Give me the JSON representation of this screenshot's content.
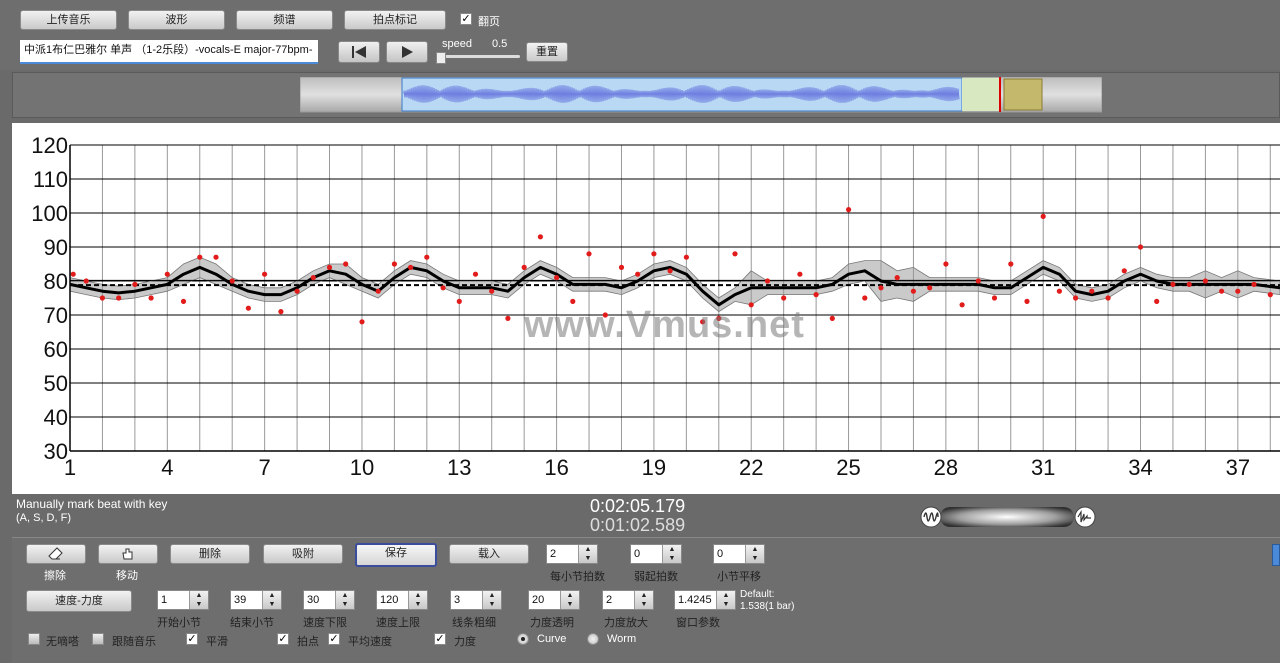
{
  "toolbar": {
    "upload": "上传音乐",
    "waveform": "波形",
    "spectrum": "频谱",
    "mark_beat": "拍点标记",
    "page_turn": "翻页",
    "speed_label": "speed",
    "speed_value": "0.5",
    "reset": "重置",
    "song_title": "中派1布仁巴雅尔 单声 （1-2乐段）-vocals-E major-77bpm-"
  },
  "chart_data": {
    "type": "line",
    "ylim": [
      30,
      120
    ],
    "yticks": [
      30,
      40,
      50,
      60,
      70,
      80,
      90,
      100,
      110,
      120
    ],
    "xlim": [
      1,
      38.3
    ],
    "xticks": [
      1,
      4,
      7,
      10,
      13,
      16,
      19,
      22,
      25,
      28,
      31,
      34,
      37
    ],
    "grid": true,
    "series": [
      {
        "kind": "curve",
        "x": [
          1,
          1.5,
          2,
          2.5,
          3,
          3.5,
          4,
          4.5,
          5,
          5.5,
          6,
          6.5,
          7,
          7.5,
          8,
          8.5,
          9,
          9.5,
          10,
          10.5,
          11,
          11.5,
          12,
          12.5,
          13,
          13.5,
          14,
          14.5,
          15,
          15.5,
          16,
          16.5,
          17,
          17.5,
          18,
          18.5,
          19,
          19.5,
          20,
          20.5,
          21,
          21.5,
          22,
          22.5,
          23,
          23.5,
          24,
          24.5,
          25,
          25.5,
          26,
          26.5,
          27,
          27.5,
          28,
          28.5,
          29,
          29.5,
          30,
          30.5,
          31,
          31.5,
          32,
          32.5,
          33,
          33.5,
          34,
          34.5,
          35,
          35.5,
          36,
          36.5,
          37,
          37.5,
          38.3
        ],
        "values": [
          79,
          78,
          77,
          76.5,
          77,
          78,
          79,
          82,
          84,
          82,
          79,
          77,
          76,
          76,
          78,
          81,
          83,
          82,
          79,
          77,
          81,
          84,
          83,
          80,
          78,
          78,
          78,
          77,
          81,
          84,
          82,
          79,
          79,
          79,
          78,
          80,
          83,
          84,
          82,
          77,
          73,
          76,
          78,
          78,
          78,
          78,
          78,
          79,
          82,
          83,
          80,
          79,
          79,
          79,
          79,
          79,
          79,
          78,
          78,
          81,
          84,
          82,
          77,
          76,
          77,
          80,
          82,
          80,
          79,
          79,
          79,
          79,
          79,
          79,
          78
        ]
      },
      {
        "kind": "band",
        "x": [
          1,
          1.5,
          2,
          2.5,
          3,
          3.5,
          4,
          4.5,
          5,
          5.5,
          6,
          6.5,
          7,
          7.5,
          8,
          8.5,
          9,
          9.5,
          10,
          10.5,
          11,
          11.5,
          12,
          12.5,
          13,
          13.5,
          14,
          14.5,
          15,
          15.5,
          16,
          16.5,
          17,
          17.5,
          18,
          18.5,
          19,
          19.5,
          20,
          20.5,
          21,
          21.5,
          22,
          22.5,
          23,
          23.5,
          24,
          24.5,
          25,
          25.5,
          26,
          26.5,
          27,
          27.5,
          28,
          28.5,
          29,
          29.5,
          30,
          30.5,
          31,
          31.5,
          32,
          32.5,
          33,
          33.5,
          34,
          34.5,
          35,
          35.5,
          36,
          36.5,
          37,
          37.5,
          38.3
        ],
        "upper": [
          81,
          80,
          79,
          78.5,
          79,
          80,
          81,
          85,
          87,
          85,
          81,
          79,
          78,
          78,
          80,
          83,
          85,
          85,
          81,
          79,
          83,
          86,
          85,
          82,
          80,
          80,
          80,
          79,
          83,
          86,
          84,
          81,
          81,
          81,
          80,
          82,
          85,
          86,
          84,
          79,
          75,
          78,
          83,
          80,
          80,
          80,
          80,
          81,
          85,
          86,
          86,
          83,
          84,
          81,
          81,
          81,
          81,
          80,
          80,
          83,
          86,
          84,
          79,
          78,
          79,
          82,
          84,
          82,
          81,
          81,
          83,
          81,
          83,
          81,
          80
        ],
        "lower": [
          77,
          76,
          75,
          74.5,
          75,
          76,
          77,
          79,
          81,
          79,
          77,
          75,
          74,
          74,
          76,
          79,
          81,
          79,
          77,
          75,
          79,
          82,
          81,
          78,
          76,
          76,
          76,
          75,
          79,
          82,
          80,
          77,
          77,
          77,
          76,
          78,
          81,
          82,
          80,
          75,
          71,
          74,
          73,
          76,
          76,
          76,
          76,
          77,
          79,
          80,
          74,
          75,
          74,
          77,
          77,
          77,
          77,
          76,
          76,
          79,
          82,
          80,
          75,
          74,
          75,
          78,
          80,
          78,
          77,
          77,
          75,
          77,
          75,
          77,
          76
        ]
      },
      {
        "kind": "mean",
        "value": 78.8
      },
      {
        "kind": "band-edge",
        "value": 80.2
      },
      {
        "kind": "points",
        "points": [
          [
            1.1,
            82
          ],
          [
            1.5,
            80
          ],
          [
            2,
            75
          ],
          [
            2.5,
            75
          ],
          [
            3,
            79
          ],
          [
            3.5,
            75
          ],
          [
            4,
            82
          ],
          [
            4.5,
            74
          ],
          [
            5,
            87
          ],
          [
            5.5,
            87
          ],
          [
            6,
            80
          ],
          [
            6.5,
            72
          ],
          [
            7,
            82
          ],
          [
            7.5,
            71
          ],
          [
            8,
            77
          ],
          [
            8.5,
            81
          ],
          [
            9,
            84
          ],
          [
            9.5,
            85
          ],
          [
            10,
            68
          ],
          [
            10.5,
            77
          ],
          [
            11,
            85
          ],
          [
            11.5,
            84
          ],
          [
            12,
            87
          ],
          [
            12.5,
            78
          ],
          [
            13,
            74
          ],
          [
            13.5,
            82
          ],
          [
            14,
            77
          ],
          [
            14.5,
            69
          ],
          [
            15,
            84
          ],
          [
            15.5,
            93
          ],
          [
            16,
            81
          ],
          [
            16.5,
            74
          ],
          [
            17,
            88
          ],
          [
            17.5,
            70
          ],
          [
            18,
            84
          ],
          [
            18.5,
            82
          ],
          [
            19,
            88
          ],
          [
            19.5,
            83
          ],
          [
            20,
            87
          ],
          [
            20.5,
            68
          ],
          [
            21,
            69
          ],
          [
            21.5,
            88
          ],
          [
            22,
            73
          ],
          [
            22.5,
            80
          ],
          [
            23,
            75
          ],
          [
            23.5,
            82
          ],
          [
            24,
            76
          ],
          [
            24.5,
            69
          ],
          [
            25,
            101
          ],
          [
            25.5,
            75
          ],
          [
            26,
            78
          ],
          [
            26.5,
            81
          ],
          [
            27,
            77
          ],
          [
            27.5,
            78
          ],
          [
            28,
            85
          ],
          [
            28.5,
            73
          ],
          [
            29,
            80
          ],
          [
            29.5,
            75
          ],
          [
            30,
            85
          ],
          [
            30.5,
            74
          ],
          [
            31,
            99
          ],
          [
            31.5,
            77
          ],
          [
            32,
            75
          ],
          [
            32.5,
            77
          ],
          [
            33,
            75
          ],
          [
            33.5,
            83
          ],
          [
            34,
            90
          ],
          [
            34.5,
            74
          ],
          [
            35,
            79
          ],
          [
            35.5,
            79
          ],
          [
            36,
            80
          ],
          [
            36.5,
            77
          ],
          [
            37,
            77
          ],
          [
            37.5,
            79
          ],
          [
            38,
            76
          ]
        ]
      }
    ]
  },
  "watermark": "www.Vmus.net",
  "hint": {
    "line1": "Manually mark beat with key",
    "line2": "(A, S, D, F)"
  },
  "time": {
    "current": "0:02:05.179",
    "secondary": "0:01:02.589"
  },
  "panel": {
    "erase": "擦除",
    "move": "移动",
    "delete": "删除",
    "snap": "吸附",
    "save": "保存",
    "load": "载入",
    "beats_per_bar_label": "每小节拍数",
    "beats_per_bar": "2",
    "pickup_label": "弱起拍数",
    "pickup": "0",
    "bar_offset_label": "小节平移",
    "bar_offset": "0",
    "tempo_dynamics": "速度-力度",
    "start_bar_label": "开始小节",
    "start_bar": "1",
    "end_bar_label": "结束小节",
    "end_bar": "39",
    "tempo_min_label": "速度下限",
    "tempo_min": "30",
    "tempo_max_label": "速度上限",
    "tempo_max": "120",
    "line_width_label": "线条粗细",
    "line_width": "3",
    "dyn_transparency_label": "力度透明",
    "dyn_transparency": "20",
    "dyn_zoom_label": "力度放大",
    "dyn_zoom": "2",
    "window_label": "窗口参数",
    "window": "1.4245",
    "default_line1": "Default:",
    "default_line2": "1.538(1 bar)",
    "no_tick": "无嘀嗒",
    "follow_music": "跟随音乐",
    "smooth": "平滑",
    "beat_points": "拍点",
    "avg_tempo": "平均速度",
    "dynamics": "力度",
    "curve": "Curve",
    "worm": "Worm"
  }
}
